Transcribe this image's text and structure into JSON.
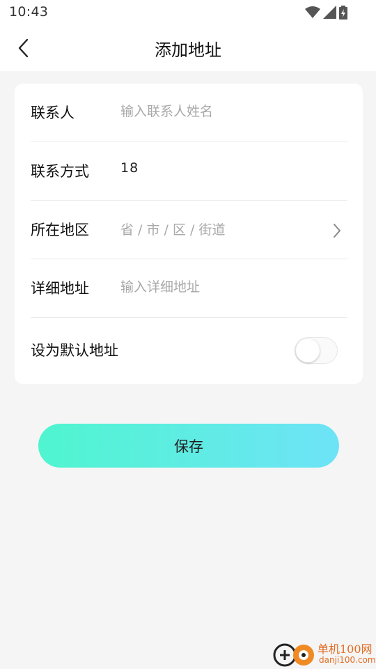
{
  "status_bar": {
    "time": "10:43",
    "icons": [
      "wifi-icon",
      "signal-icon",
      "battery-charging-icon"
    ]
  },
  "header": {
    "back_icon": "chevron-left-icon",
    "title": "添加地址"
  },
  "form": {
    "contact": {
      "label": "联系人",
      "placeholder": "输入联系人姓名",
      "value": ""
    },
    "phone": {
      "label": "联系方式",
      "value": "18"
    },
    "region": {
      "label": "所在地区",
      "placeholder": "省 / 市 / 区 / 街道",
      "icon": "chevron-right-icon"
    },
    "detail": {
      "label": "详细地址",
      "placeholder": "输入详细地址",
      "value": ""
    },
    "default": {
      "label": "设为默认地址",
      "enabled": false
    }
  },
  "actions": {
    "save_label": "保存"
  },
  "watermark": {
    "name": "单机100网",
    "domain": "danji100.com"
  },
  "colors": {
    "accent_start": "#4ff5cf",
    "accent_end": "#6ee3f7",
    "background": "#f5f5f5",
    "watermark": "#e56b1f"
  }
}
